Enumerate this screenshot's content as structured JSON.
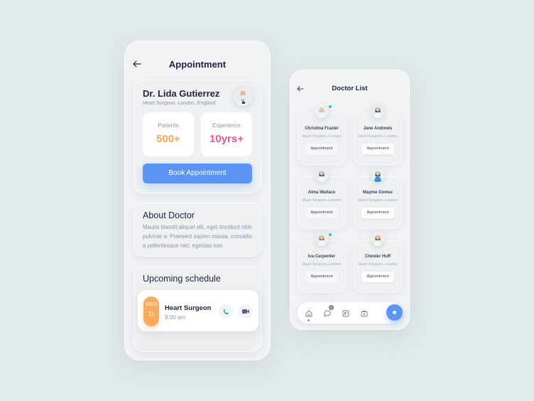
{
  "appointment": {
    "title": "Appointment",
    "doctor": {
      "name": "Dr. Lida Gutierrez",
      "subtitle": "Heart Surgeon, London, England"
    },
    "stats": [
      {
        "label": "Patients",
        "value": "500+",
        "color": "#f8a552"
      },
      {
        "label": "Experience",
        "value": "10yrs+",
        "color": "#f0509c"
      }
    ],
    "book_button": "Book Appointment",
    "about": {
      "title": "About Doctor",
      "text": "Mauris blandit aliquet elit, eget tincidunt nibh pulvinar a. Praesent sapien massa, convallis a pellentesque nec, egestas non"
    },
    "schedule": {
      "title": "Upcoming schedule",
      "items": [
        {
          "day": "WED",
          "date": "11",
          "name": "Heart Surgeon",
          "time": "9:00 am"
        }
      ]
    }
  },
  "doctor_list": {
    "title": "Doctor List",
    "button_label": "Appointment",
    "doctors": [
      {
        "name": "Christina Frazier",
        "subtitle": "Heart Surgeon, London",
        "online": true
      },
      {
        "name": "Jane Andrews",
        "subtitle": "Heart Surgeon, London",
        "online": false
      },
      {
        "name": "Alma Wallace",
        "subtitle": "Heart Surgeon, London",
        "online": false
      },
      {
        "name": "Mayme Gomez",
        "subtitle": "Heart Surgeon, London",
        "online": false
      },
      {
        "name": "Iva Carpenter",
        "subtitle": "Heart Surgeon, London",
        "online": true
      },
      {
        "name": "Chester Huff",
        "subtitle": "Heart Surgeon, London",
        "online": false
      }
    ],
    "nav": {
      "items": [
        "home-icon",
        "chat-icon",
        "contacts-icon",
        "medical-kit-icon"
      ],
      "active": "home-icon",
      "chat_badge": "2"
    }
  },
  "colors": {
    "accent": "#5b94f5",
    "orange": "#f8ab5c",
    "pink": "#f0509c",
    "teal": "#2ec4c0"
  }
}
